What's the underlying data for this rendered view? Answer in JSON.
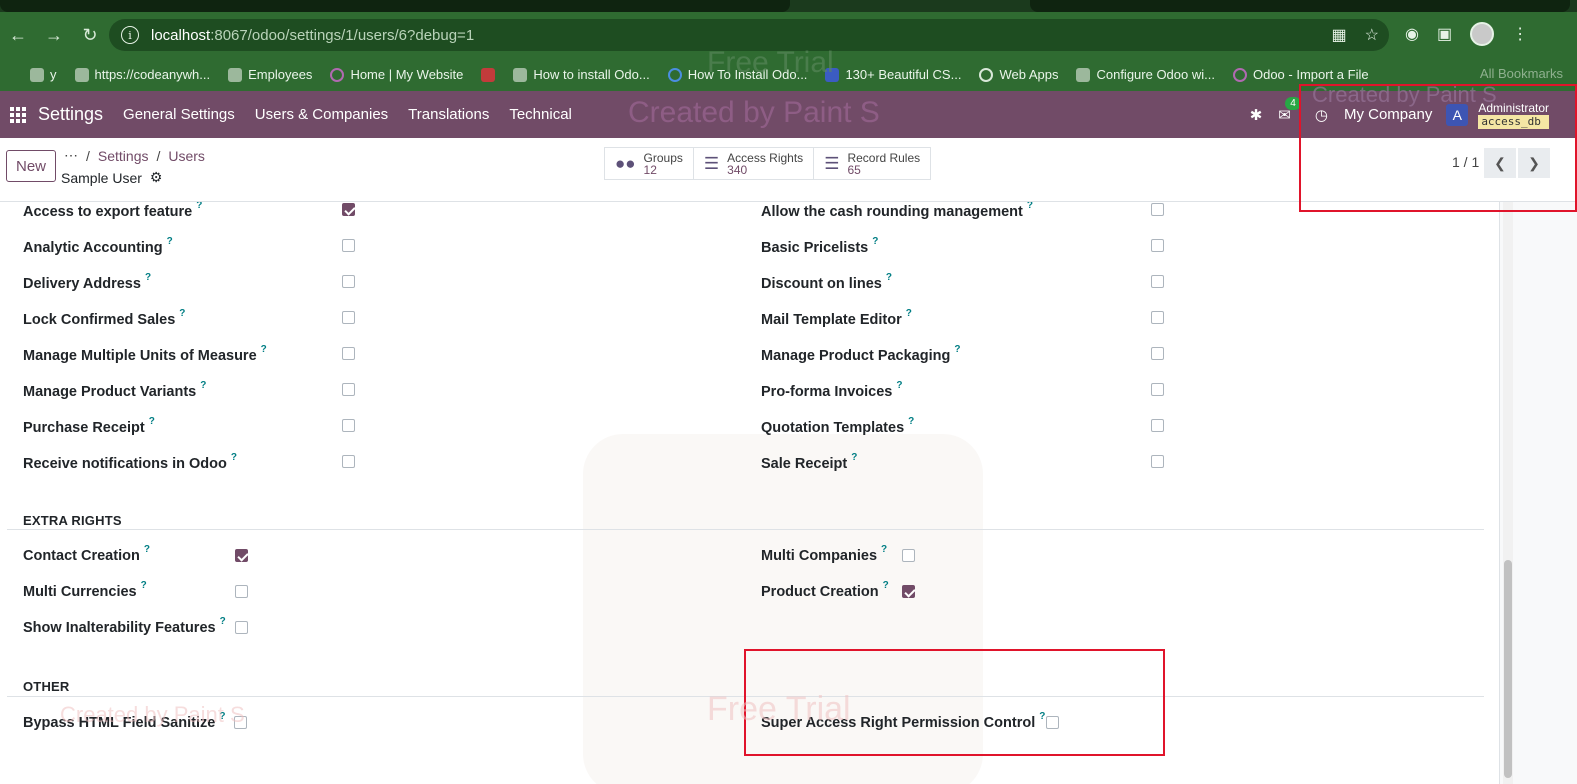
{
  "browser": {
    "url_host": "localhost",
    "url_path": ":8067/odoo/settings/1/users/6?debug=1",
    "bookmarks": [
      {
        "label": "y"
      },
      {
        "label": "https://codeanywh..."
      },
      {
        "label": "Employees"
      },
      {
        "label": "Home | My Website"
      },
      {
        "label": ""
      },
      {
        "label": "How to install Odo..."
      },
      {
        "label": "How To Install Odo..."
      },
      {
        "label": "130+ Beautiful CS..."
      },
      {
        "label": "Web Apps"
      },
      {
        "label": "Configure Odoo wi..."
      },
      {
        "label": "Odoo - Import a File"
      }
    ],
    "all_bookmarks": "All Bookmarks"
  },
  "nav": {
    "brand": "Settings",
    "menu": [
      "General Settings",
      "Users & Companies",
      "Translations",
      "Technical"
    ],
    "chat_count": "4",
    "company": "My Company",
    "user_initial": "A",
    "user_name": "Administrator",
    "db_name": "access_db"
  },
  "control": {
    "new_label": "New",
    "breadcrumb": [
      "Settings",
      "Users"
    ],
    "record_name": "Sample User",
    "smart_buttons": [
      {
        "label": "Groups",
        "value": "12",
        "icon": "users-icon"
      },
      {
        "label": "Access Rights",
        "value": "340",
        "icon": "list-icon"
      },
      {
        "label": "Record Rules",
        "value": "65",
        "icon": "list-icon"
      }
    ],
    "pager": "1 / 1"
  },
  "rights_left": [
    {
      "label": "Access to export feature",
      "checked": true
    },
    {
      "label": "Analytic Accounting",
      "checked": false
    },
    {
      "label": "Delivery Address",
      "checked": false
    },
    {
      "label": "Lock Confirmed Sales",
      "checked": false
    },
    {
      "label": "Manage Multiple Units of Measure",
      "checked": false
    },
    {
      "label": "Manage Product Variants",
      "checked": false
    },
    {
      "label": "Purchase Receipt",
      "checked": false
    },
    {
      "label": "Receive notifications in Odoo",
      "checked": false
    }
  ],
  "rights_right": [
    {
      "label": "Allow the cash rounding management",
      "checked": false
    },
    {
      "label": "Basic Pricelists",
      "checked": false
    },
    {
      "label": "Discount on lines",
      "checked": false
    },
    {
      "label": "Mail Template Editor",
      "checked": false
    },
    {
      "label": "Manage Product Packaging",
      "checked": false
    },
    {
      "label": "Pro-forma Invoices",
      "checked": false
    },
    {
      "label": "Quotation Templates",
      "checked": false
    },
    {
      "label": "Sale Receipt",
      "checked": false
    }
  ],
  "extra_rights": {
    "title": "EXTRA RIGHTS",
    "left": [
      {
        "label": "Contact Creation",
        "checked": true
      },
      {
        "label": "Multi Currencies",
        "checked": false
      },
      {
        "label": "Show Inalterability Features",
        "checked": false
      }
    ],
    "right": [
      {
        "label": "Multi Companies",
        "checked": false
      },
      {
        "label": "Product Creation",
        "checked": true
      }
    ]
  },
  "other": {
    "title": "OTHER",
    "left": [
      {
        "label": "Bypass HTML Field Sanitize",
        "checked": false
      }
    ],
    "right": [
      {
        "label": "Super Access Right Permission Control",
        "checked": false
      }
    ]
  },
  "help_mark": "?",
  "watermarks": [
    "Free Trial",
    "Created by Paint S",
    "Free Trial",
    "Created by Paint S",
    "Created by Paint S",
    "Free Trial"
  ],
  "colors": {
    "odoo_purple": "#714b67",
    "highlight_red": "#e0142b",
    "chrome_green": "#2f6b31"
  }
}
